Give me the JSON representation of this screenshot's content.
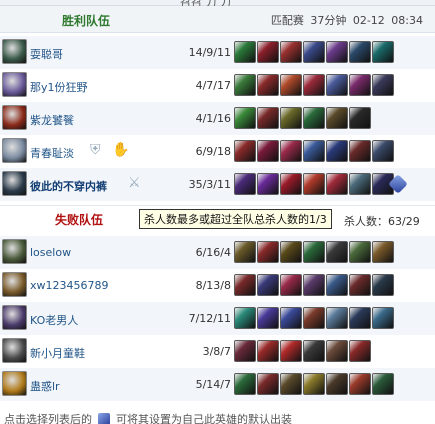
{
  "top_cut_text": "召召 刀 刀",
  "win_team": {
    "title": "胜利队伍",
    "match_type": "匹配赛",
    "duration": "37分钟",
    "datetime": "02-12 08:34",
    "players": [
      {
        "name": "耍聪哥",
        "kda": "14/9/11",
        "avatar_color": "#3a5a4a",
        "items": [
          "#2a7a3a",
          "#8a1f2a",
          "#9a3030",
          "#3a4a8a",
          "#6a3a8a",
          "#2a4a6a",
          "#1a6a6a"
        ]
      },
      {
        "name": "那y1份狂野",
        "kda": "4/7/17",
        "avatar_color": "#6a5a9a",
        "items": [
          "#3a7a3a",
          "#8a2a2a",
          "#b04a2a",
          "#9a2a3a",
          "#4a5a9a",
          "#7a2a6a",
          "#3a3a5a"
        ]
      },
      {
        "name": "紫龙饕餮",
        "kda": "4/1/16",
        "avatar_color": "#8a2a1a",
        "items": [
          "#3a8a3a",
          "#7a2a2a",
          "#6a6a2a",
          "#2a6a3a",
          "#5a4a2a",
          "#2a2a2a"
        ]
      },
      {
        "name": "青春耻淡",
        "kda": "6/9/18",
        "avatar_color": "#7a8aa0",
        "items": [
          "#8a2a2a",
          "#7a1a3a",
          "#9a2a4a",
          "#3a5a9a",
          "#2a3a7a",
          "#6a2a2a",
          "#3a4a6a"
        ]
      },
      {
        "name": "彼此的不穿内裤",
        "kda": "35/3/11",
        "avatar_color": "#2a3a4a",
        "bold": true,
        "items": [
          "#4a2a7a",
          "#6a2a9a",
          "#9a1a2a",
          "#b03a2a",
          "#a02a3a",
          "#4a6a7a",
          "#2a2a5a"
        ]
      }
    ]
  },
  "lose_team": {
    "title": "失败队伍",
    "kill_count_label": "杀人数：63/29",
    "players": [
      {
        "name": "loselow",
        "kda": "6/16/4",
        "avatar_color": "#4a5a3a",
        "items": [
          "#6a5a2a",
          "#8a2a2a",
          "#5a4a1a",
          "#2a6a3a",
          "#3a3a3a",
          "#4a6a3a",
          "#7a5a2a"
        ]
      },
      {
        "name": "xw123456789",
        "kda": "8/13/8",
        "avatar_color": "#7a5a2a",
        "items": [
          "#7a2a2a",
          "#3a3a7a",
          "#9a2a4a",
          "#5a3a6a",
          "#3a5a8a",
          "#6a2a2a",
          "#2a3a4a"
        ]
      },
      {
        "name": "KO老男人",
        "kda": "7/12/11",
        "avatar_color": "#4a3a6a",
        "items": [
          "#2a8a7a",
          "#4a3a9a",
          "#3a4a9a",
          "#7a3a2a",
          "#5a7a9a",
          "#2a3a5a",
          "#3a6a8a"
        ]
      },
      {
        "name": "新小月童鞋",
        "kda": "3/8/7",
        "avatar_color": "#4a4a4a",
        "items": [
          "#6a2a3a",
          "#9a2a2a",
          "#b02a2a",
          "#3a3a3a",
          "#6a4a3a",
          "#8a2a2a"
        ]
      },
      {
        "name": "蛊惑lr",
        "kda": "5/14/7",
        "avatar_color": "#b07a1a",
        "items": [
          "#2a6a3a",
          "#7a2a2a",
          "#5a4a2a",
          "#8a7a2a",
          "#4a3a2a",
          "#9a3a2a",
          "#2a5a3a"
        ]
      }
    ]
  },
  "tooltip_text": "杀人数最多或超过全队总杀人数的1/3",
  "footer": {
    "text_before": "点击选择列表后的",
    "text_after": "可将其设置为自己此英雄的默认出装"
  },
  "colors": {
    "win_title": "#2f7a2f",
    "lose_title": "#b01010",
    "name_link": "#225588"
  }
}
